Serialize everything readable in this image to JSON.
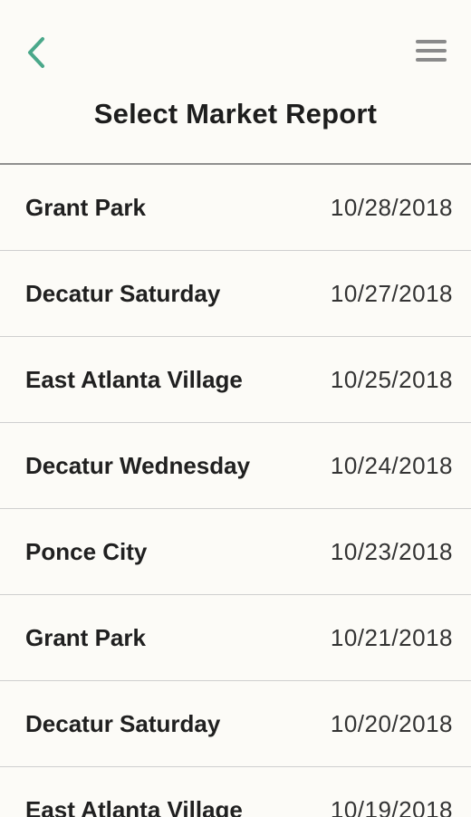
{
  "header": {
    "title": "Select Market Report",
    "back_icon": "chevron-left-icon",
    "menu_icon": "hamburger-menu-icon",
    "accent_color": "#4aa88a",
    "menu_color": "#8a8a8a"
  },
  "reports": [
    {
      "name": "Grant Park",
      "date": "10/28/2018"
    },
    {
      "name": "Decatur Saturday",
      "date": "10/27/2018"
    },
    {
      "name": "East Atlanta Village",
      "date": "10/25/2018"
    },
    {
      "name": "Decatur Wednesday",
      "date": "10/24/2018"
    },
    {
      "name": "Ponce City",
      "date": "10/23/2018"
    },
    {
      "name": "Grant Park",
      "date": "10/21/2018"
    },
    {
      "name": "Decatur Saturday",
      "date": "10/20/2018"
    },
    {
      "name": "East Atlanta Village",
      "date": "10/19/2018"
    }
  ]
}
